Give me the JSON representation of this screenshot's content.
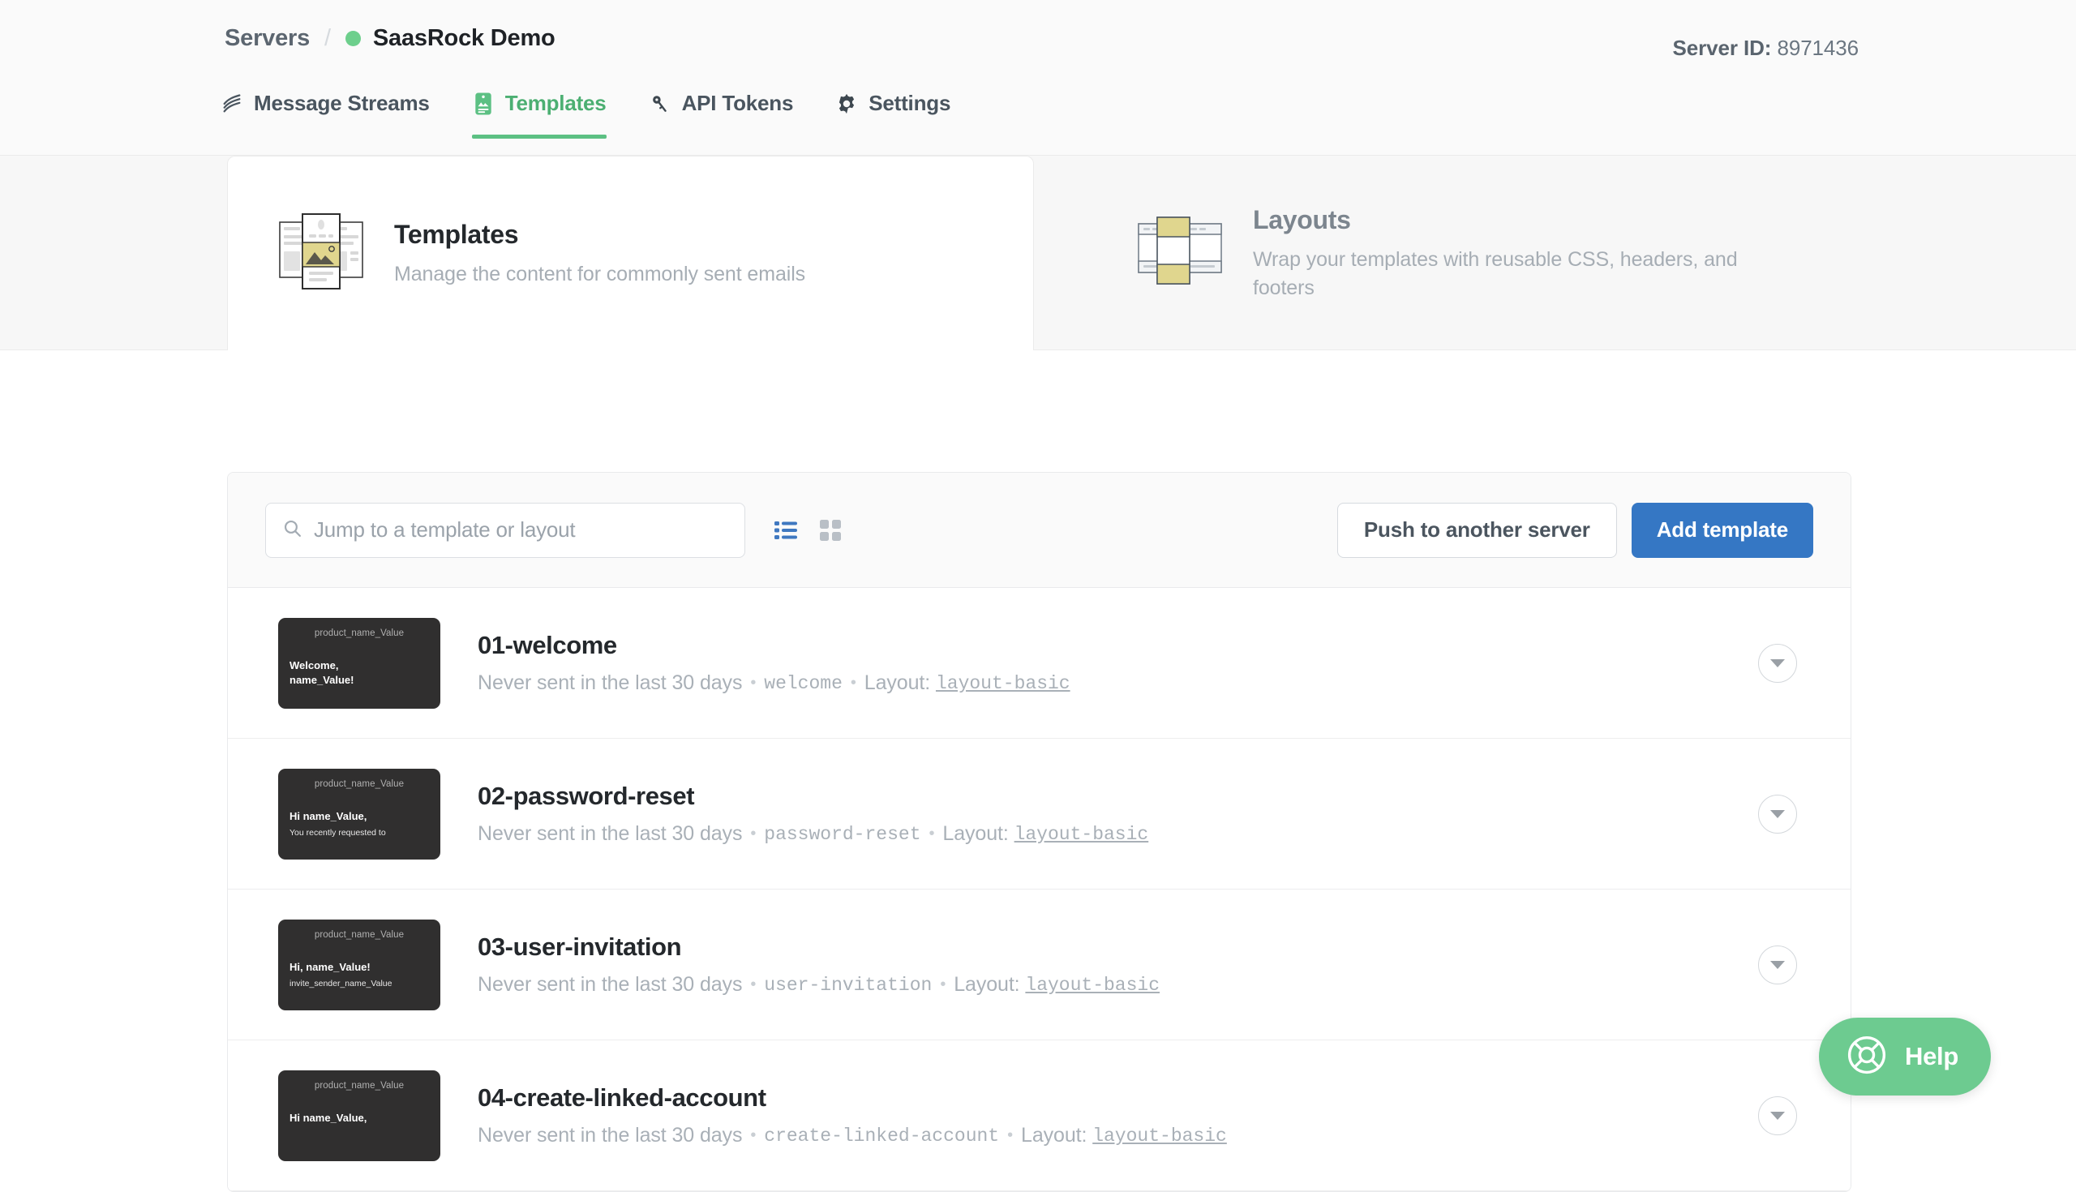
{
  "header": {
    "breadcrumb": {
      "root": "Servers",
      "separator": "/",
      "current": "SaasRock Demo",
      "status_color": "#6dcf8c"
    },
    "server_id_label": "Server ID:",
    "server_id_value": "8971436"
  },
  "tabs": [
    {
      "label": "Message Streams",
      "icon": "streams-icon",
      "active": false
    },
    {
      "label": "Templates",
      "icon": "template-icon",
      "active": true
    },
    {
      "label": "API Tokens",
      "icon": "key-icon",
      "active": false
    },
    {
      "label": "Settings",
      "icon": "gear-icon",
      "active": false
    }
  ],
  "promo": {
    "templates": {
      "title": "Templates",
      "description": "Manage the content for commonly sent emails"
    },
    "layouts": {
      "title": "Layouts",
      "description": "Wrap your templates with reusable CSS, headers, and footers"
    }
  },
  "toolbar": {
    "search_placeholder": "Jump to a template or layout",
    "search_value": "",
    "view_list_icon": "list-view-icon",
    "view_grid_icon": "grid-view-icon",
    "push_label": "Push to another server",
    "add_label": "Add template",
    "primary_color": "#3577c4"
  },
  "templates": [
    {
      "name": "01-welcome",
      "sent_status": "Never sent in the last 30 days",
      "alias": "welcome",
      "layout_label": "Layout:",
      "layout_name": "layout-basic",
      "thumb_head": "product_name_Value",
      "thumb_line1": "Welcome,",
      "thumb_line2": "name_Value!",
      "thumb_line3": ""
    },
    {
      "name": "02-password-reset",
      "sent_status": "Never sent in the last 30 days",
      "alias": "password-reset",
      "layout_label": "Layout:",
      "layout_name": "layout-basic",
      "thumb_head": "product_name_Value",
      "thumb_line1": "Hi name_Value,",
      "thumb_line2": "",
      "thumb_line3": "You recently requested to"
    },
    {
      "name": "03-user-invitation",
      "sent_status": "Never sent in the last 30 days",
      "alias": "user-invitation",
      "layout_label": "Layout:",
      "layout_name": "layout-basic",
      "thumb_head": "product_name_Value",
      "thumb_line1": "Hi, name_Value!",
      "thumb_line2": "",
      "thumb_line3": "invite_sender_name_Value"
    },
    {
      "name": "04-create-linked-account",
      "sent_status": "Never sent in the last 30 days",
      "alias": "create-linked-account",
      "layout_label": "Layout:",
      "layout_name": "layout-basic",
      "thumb_head": "product_name_Value",
      "thumb_line1": "Hi name_Value,",
      "thumb_line2": "",
      "thumb_line3": ""
    }
  ],
  "help": {
    "label": "Help",
    "icon": "lifebuoy-icon",
    "color": "#6dcb90"
  }
}
